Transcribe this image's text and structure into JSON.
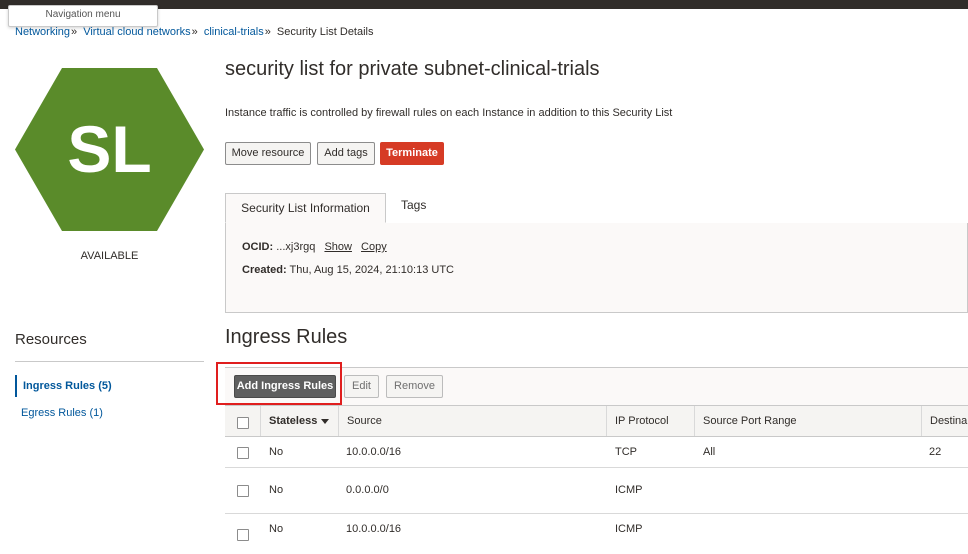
{
  "header": {
    "nav_menu_label": "Navigation menu"
  },
  "breadcrumb": {
    "items": [
      "Networking",
      "Virtual cloud networks",
      "clinical-trials"
    ],
    "separator": "»",
    "current": "Security List Details"
  },
  "resource_icon": {
    "text": "SL",
    "color": "#5a8b2a",
    "status": "AVAILABLE"
  },
  "page": {
    "title": "security list for private subnet-clinical-trials",
    "description": "Instance traffic is controlled by firewall rules on each Instance in addition to this Security List"
  },
  "actions": {
    "move_label": "Move resource",
    "tags_label": "Add tags",
    "terminate_label": "Terminate"
  },
  "tabs": {
    "info_label": "Security List Information",
    "tags_label": "Tags"
  },
  "info": {
    "ocid_label": "OCID:",
    "ocid_value": "...xj3rgq",
    "show_label": "Show",
    "copy_label": "Copy",
    "created_label": "Created:",
    "created_value": "Thu, Aug 15, 2024, 21:10:13 UTC"
  },
  "resources": {
    "title": "Resources",
    "items": [
      {
        "label": "Ingress Rules",
        "count": "(5)"
      },
      {
        "label": "Egress Rules",
        "count": "(1)"
      }
    ]
  },
  "ingress": {
    "title": "Ingress Rules",
    "add_label": "Add Ingress Rules",
    "edit_label": "Edit",
    "remove_label": "Remove",
    "columns": [
      "Stateless",
      "Source",
      "IP Protocol",
      "Source Port Range",
      "Destina"
    ],
    "rows": [
      {
        "stateless": "No",
        "source": "10.0.0.0/16",
        "protocol": "TCP",
        "port_range": "All",
        "dest": "22"
      },
      {
        "stateless": "No",
        "source": "0.0.0.0/0",
        "protocol": "ICMP",
        "port_range": "",
        "dest": ""
      },
      {
        "stateless": "No",
        "source": "10.0.0.0/16",
        "protocol": "ICMP",
        "port_range": "",
        "dest": ""
      }
    ]
  },
  "colors": {
    "link": "#01579b",
    "terminate": "#d63b25",
    "highlight": "#e01e1e"
  }
}
